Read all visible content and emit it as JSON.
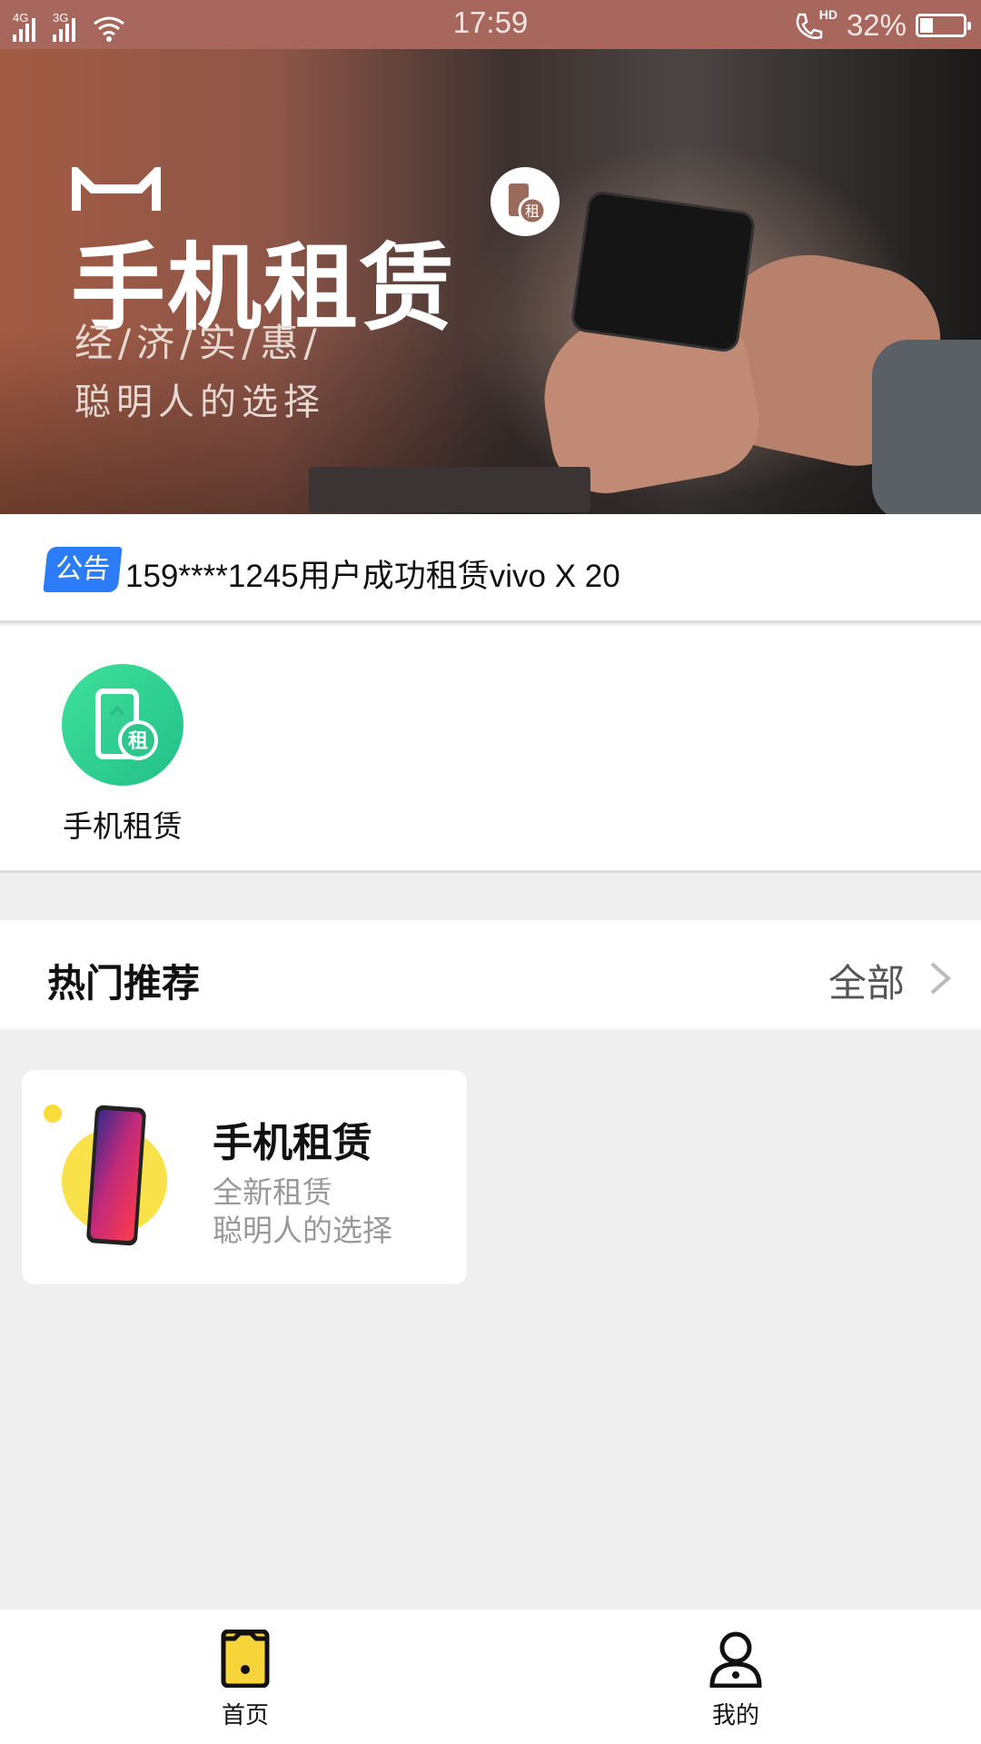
{
  "status_bar": {
    "net1": "4G",
    "net2": "3G",
    "time": "17:59",
    "hd": "HD",
    "battery_percent": "32%",
    "battery_level": 0.32,
    "icons": [
      "signal-icon",
      "signal-icon",
      "wifi-icon",
      "call-hd-icon",
      "battery-icon"
    ]
  },
  "banner": {
    "title": "手机租赁",
    "subtitle1": "经/济/实/惠/",
    "subtitle2": "聪明人的选择",
    "badge_char": "租"
  },
  "notice": {
    "tag": "公告",
    "text": "159****1245用户成功租赁vivo X 20"
  },
  "categories": [
    {
      "label": "手机租赁",
      "icon": "phone-rent-icon",
      "badge_char": "租",
      "color": "#33d192"
    }
  ],
  "section": {
    "title": "热门推荐",
    "more": "全部",
    "chevron_icon": "chevron-right-icon"
  },
  "cards": [
    {
      "title": "手机租赁",
      "subtitle1": "全新租赁",
      "subtitle2": "聪明人的选择",
      "image": "smartphone-image"
    }
  ],
  "bottom_nav": [
    {
      "label": "首页",
      "icon": "home-phone-icon",
      "active": true,
      "accent": "#f7d43a"
    },
    {
      "label": "我的",
      "icon": "user-icon",
      "active": false
    }
  ]
}
